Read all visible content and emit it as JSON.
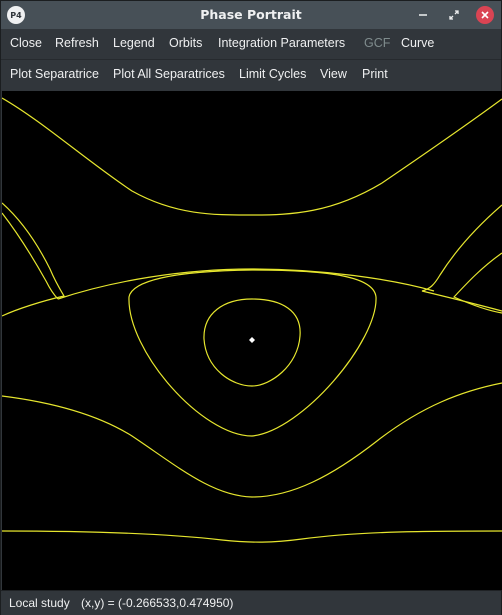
{
  "window": {
    "title": "Phase Portrait",
    "logo_text": "P4",
    "controls": {
      "minimize": "minimize-icon",
      "maximize": "restore-icon",
      "close": "close-icon"
    }
  },
  "toolbar_row1": [
    {
      "label": "Close",
      "enabled": true
    },
    {
      "label": "Refresh",
      "enabled": true
    },
    {
      "label": "Legend",
      "enabled": true
    },
    {
      "label": "Orbits",
      "enabled": true
    },
    {
      "label": "Integration Parameters",
      "enabled": true
    },
    {
      "label": "GCF",
      "enabled": false
    },
    {
      "label": "Curve",
      "enabled": true
    }
  ],
  "toolbar_row2": [
    {
      "label": "Plot Separatrice",
      "enabled": true
    },
    {
      "label": "Plot All Separatrices",
      "enabled": true
    },
    {
      "label": "Limit Cycles",
      "enabled": true
    },
    {
      "label": "View",
      "enabled": true
    },
    {
      "label": "Print",
      "enabled": true
    }
  ],
  "status": {
    "mode": "Local study",
    "coords": "(x,y) = (-0.266533,0.474950)"
  },
  "colors": {
    "orbit": "#e6e62e",
    "singular_point": "#ffffff",
    "canvas_bg": "#000000"
  }
}
